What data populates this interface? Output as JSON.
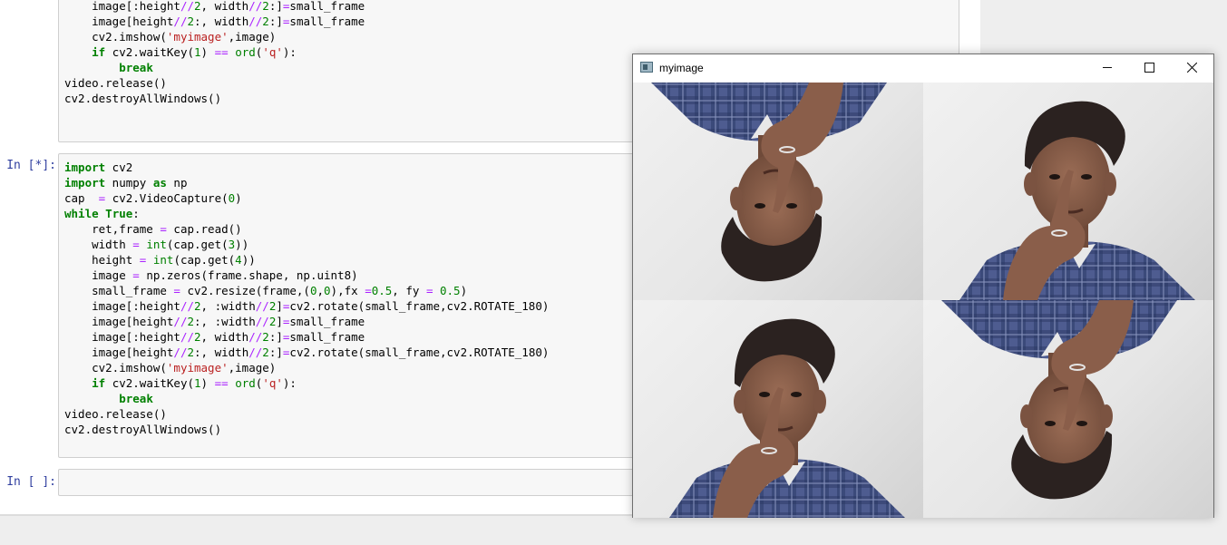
{
  "notebook": {
    "cells": [
      {
        "prompt": "",
        "lines": [
          "    image[:height//2, width//2:]=small_frame",
          "    image[height//2:, width//2:]=small_frame",
          "    cv2.imshow('myimage',image)",
          "    if cv2.waitKey(1) == ord('q'):",
          "        break",
          "video.release()",
          "cv2.destroyAllWindows()"
        ]
      },
      {
        "prompt": "In [*]:",
        "lines": [
          "import cv2",
          "import numpy as np",
          "cap  = cv2.VideoCapture(0)",
          "while True:",
          "    ret,frame = cap.read()",
          "    width = int(cap.get(3))",
          "    height = int(cap.get(4))",
          "    image = np.zeros(frame.shape, np.uint8)",
          "    small_frame = cv2.resize(frame,(0,0),fx =0.5, fy = 0.5)",
          "    image[:height//2, :width//2]=cv2.rotate(small_frame,cv2.ROTATE_180)",
          "    image[height//2:, :width//2]=small_frame",
          "    image[:height//2, width//2:]=small_frame",
          "    image[height//2:, width//2:]=cv2.rotate(small_frame,cv2.ROTATE_180)",
          "    cv2.imshow('myimage',image)",
          "    if cv2.waitKey(1) == ord('q'):",
          "        break",
          "video.release()",
          "cv2.destroyAllWindows()"
        ]
      },
      {
        "prompt": "In [ ]:",
        "lines": []
      }
    ]
  },
  "window": {
    "title": "myimage",
    "icon": "app-window-icon",
    "controls": [
      "minimize-icon",
      "maximize-icon",
      "close-icon"
    ],
    "quadrants": [
      {
        "position": "top-left",
        "orientation": "rotated-180"
      },
      {
        "position": "top-right",
        "orientation": "normal"
      },
      {
        "position": "bottom-left",
        "orientation": "normal"
      },
      {
        "position": "bottom-right",
        "orientation": "rotated-180"
      }
    ]
  },
  "colors": {
    "prompt": "#303f9f",
    "keyword": "#008000",
    "operator": "#aa22ff",
    "string": "#ba2121",
    "cell_bg": "#f7f7f7"
  }
}
